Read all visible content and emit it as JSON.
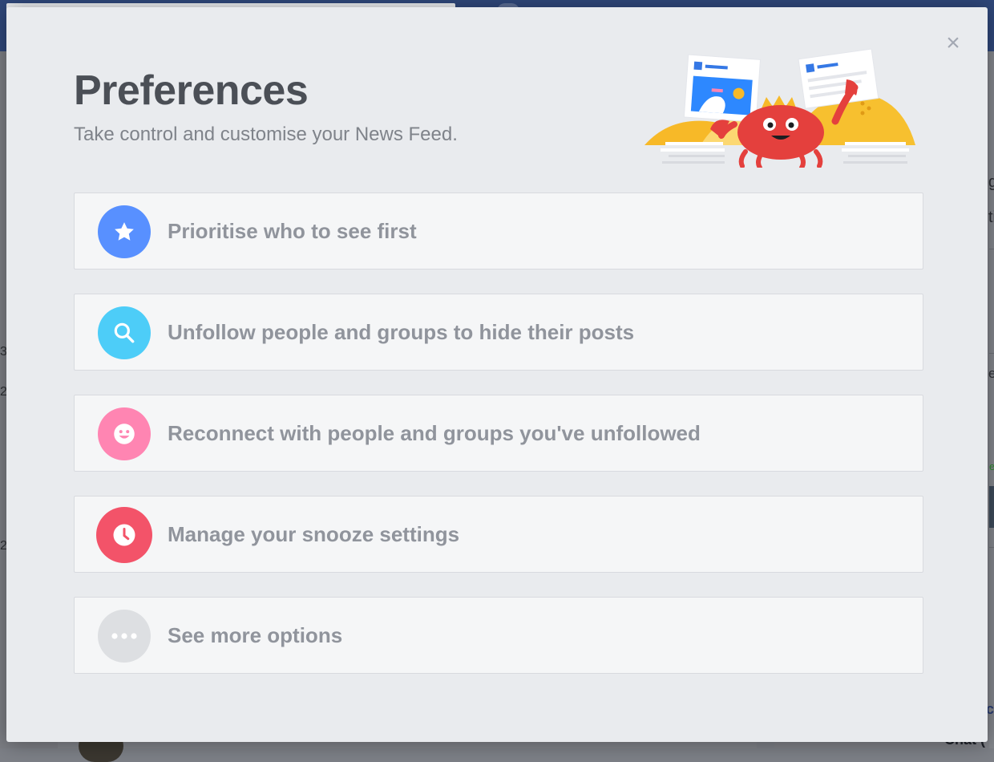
{
  "modal": {
    "title": "Preferences",
    "subtitle": "Take control and customise your News Feed.",
    "close_glyph": "×"
  },
  "options": [
    {
      "label": "Prioritise who to see first",
      "icon": "star-icon",
      "color": "#5890ff"
    },
    {
      "label": "Unfollow people and groups to hide their posts",
      "icon": "search-icon",
      "color": "#4dcdf8"
    },
    {
      "label": "Reconnect with people and groups you've unfollowed",
      "icon": "smiley-icon",
      "color": "#ff85b2"
    },
    {
      "label": "Manage your snooze settings",
      "icon": "clock-icon",
      "color": "#f35369"
    },
    {
      "label": "See more options",
      "icon": "more-icon",
      "color": "#dddfe2"
    }
  ],
  "background": {
    "chat_label": "Chat (",
    "side_fragments": [
      "ge",
      "ti",
      "ev"
    ]
  }
}
